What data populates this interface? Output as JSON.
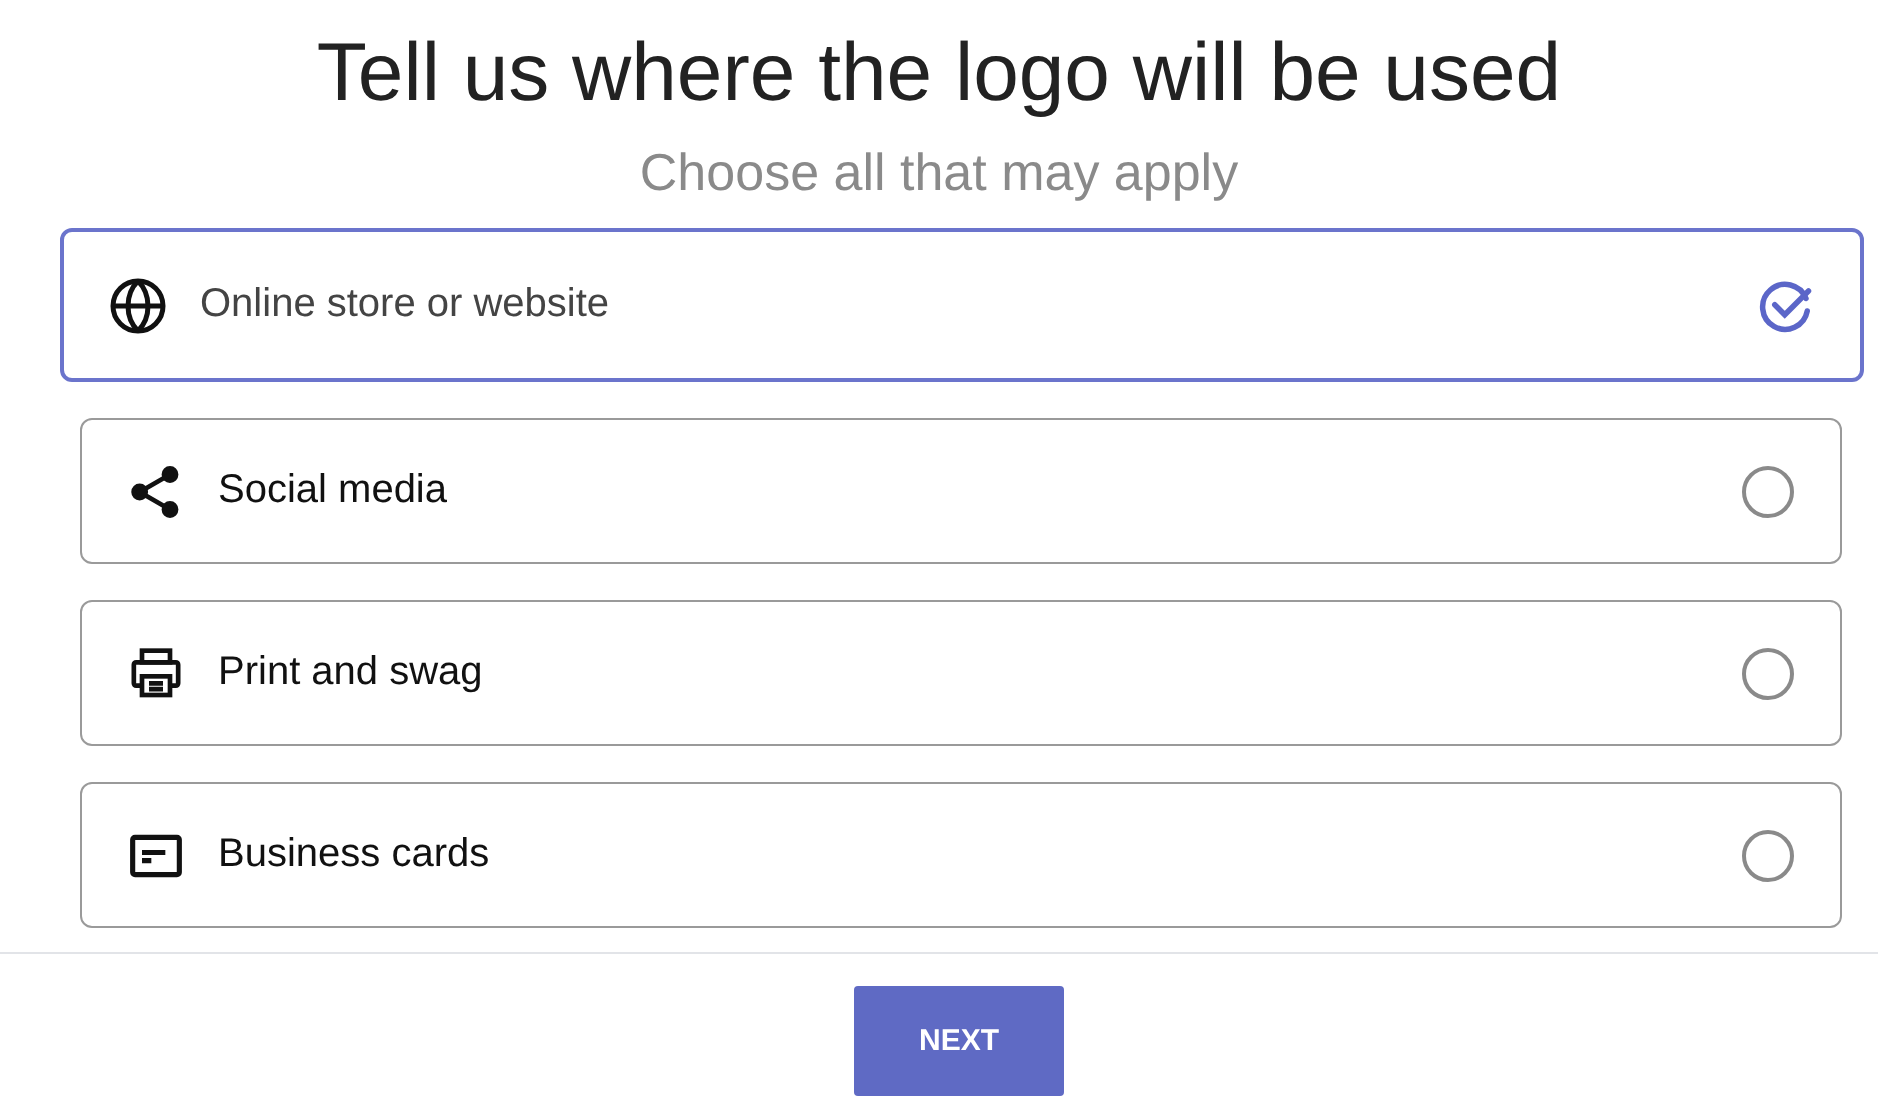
{
  "title": "Tell us where the logo will be used",
  "subtitle": "Choose all that may apply",
  "options": [
    {
      "kind": "globe",
      "label": "Online store or website",
      "selected": true
    },
    {
      "kind": "share",
      "label": "Social media",
      "selected": false
    },
    {
      "kind": "printer",
      "label": "Print and swag",
      "selected": false
    },
    {
      "kind": "card",
      "label": "Business cards",
      "selected": false
    }
  ],
  "next_button": "NEXT"
}
